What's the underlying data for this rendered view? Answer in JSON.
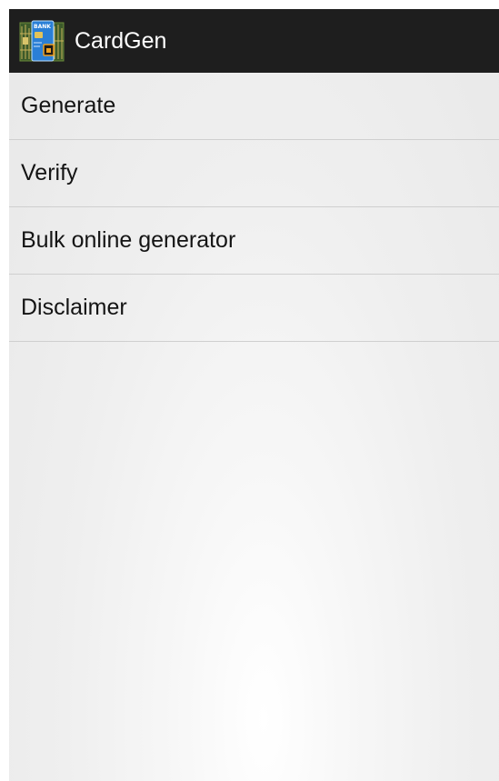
{
  "action_bar": {
    "title": "CardGen",
    "icon": "cardgen-app-icon",
    "icon_text": "BANK",
    "background": "#1e1e1e"
  },
  "menu": {
    "items": [
      {
        "label": "Generate"
      },
      {
        "label": "Verify"
      },
      {
        "label": "Bulk online generator"
      },
      {
        "label": "Disclaimer"
      }
    ]
  }
}
